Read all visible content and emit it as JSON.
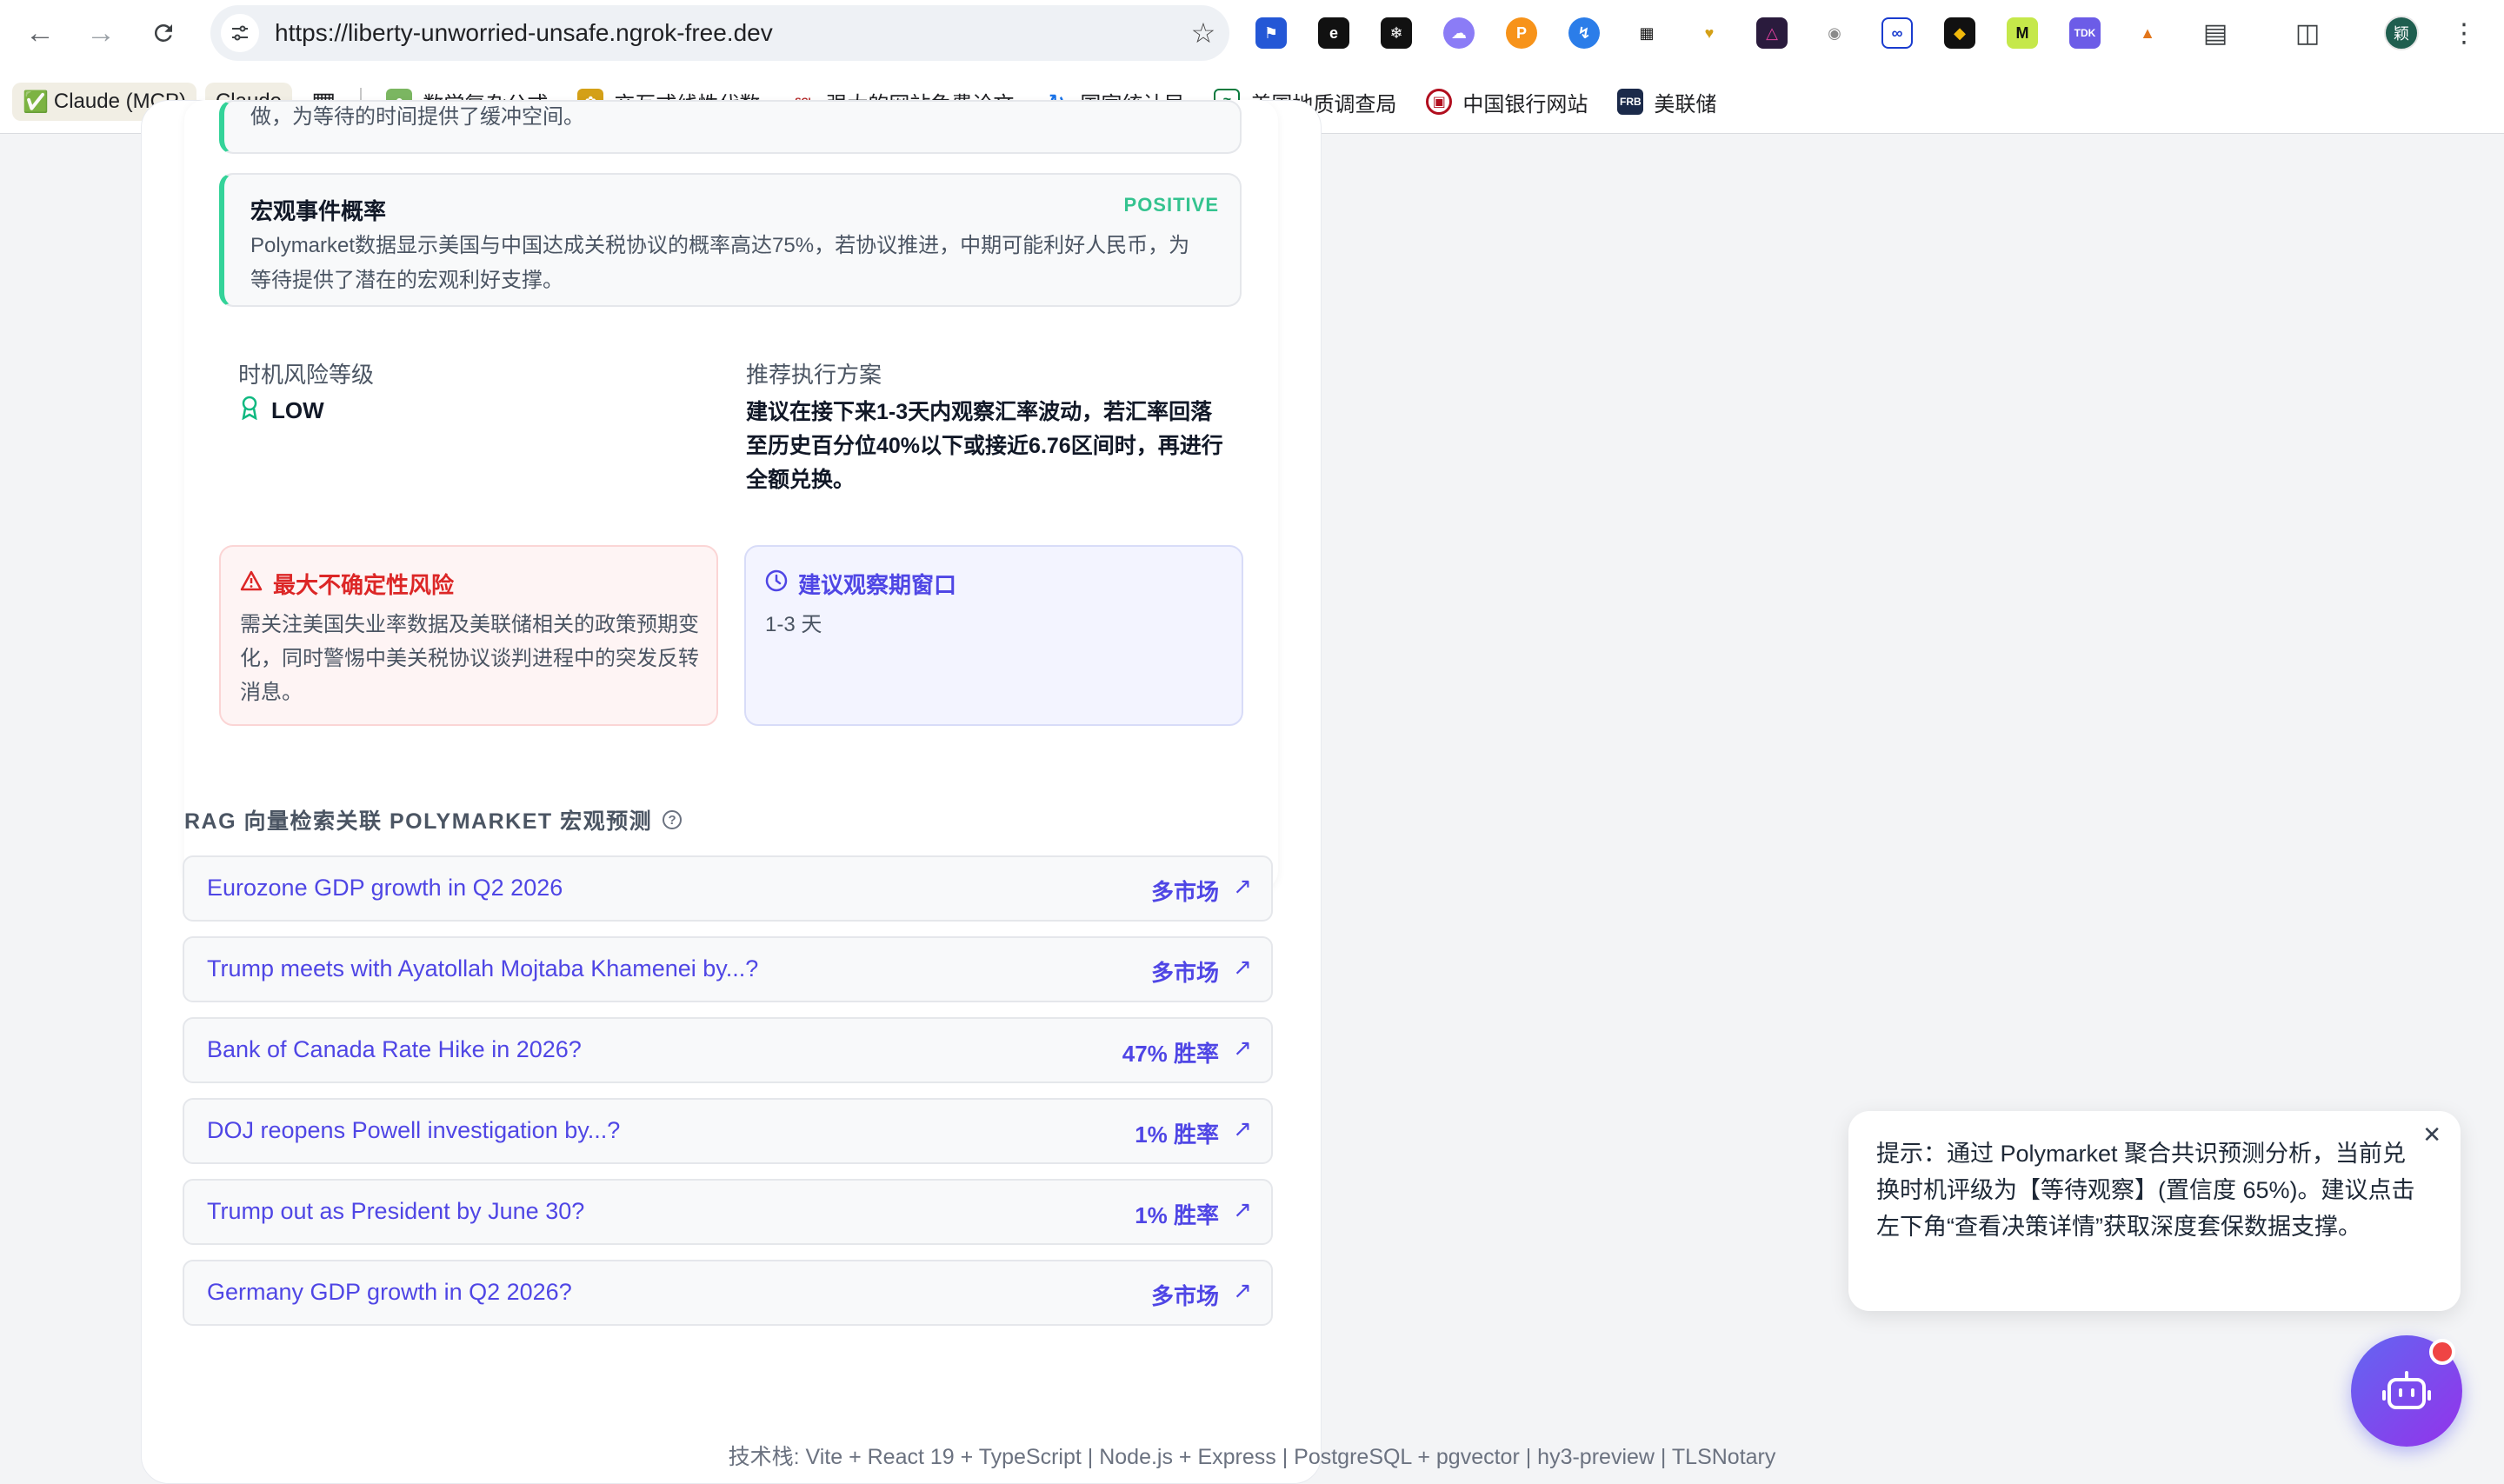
{
  "browser": {
    "url": "https://liberty-unworried-unsafe.ngrok-free.dev",
    "avatar_label": "颖"
  },
  "bookmarks": [
    {
      "label": "Claude (MCP)",
      "icon": "check-icon",
      "prefix": "✅"
    },
    {
      "label": "Claude",
      "icon": "none"
    },
    {
      "label": "数学复杂公式",
      "icon": "frog-icon"
    },
    {
      "label": "交互式线性代数",
      "icon": "bee-icon"
    },
    {
      "label": "强大的网站免费论文",
      "icon": "scihub-icon"
    },
    {
      "label": "国家统计局",
      "icon": "stats-icon"
    },
    {
      "label": "美国地质调查局",
      "icon": "usgs-icon"
    },
    {
      "label": "中国银行网站",
      "icon": "boc-icon"
    },
    {
      "label": "美联储",
      "icon": "frb-icon"
    }
  ],
  "factor_partial": {
    "text": "做，为等待的时间提供了缓冲空间。"
  },
  "factor": {
    "title": "宏观事件概率",
    "tag": "POSITIVE",
    "body": "Polymarket数据显示美国与中国达成关税协议的概率高达75%，若协议推进，中期可能利好人民币，为等待提供了潜在的宏观利好支撑。"
  },
  "timing": {
    "risk_label": "时机风险等级",
    "risk_value": "LOW",
    "plan_label": "推荐执行方案",
    "plan_text": "建议在接下来1-3天内观察汇率波动，若汇率回落至历史百分位40%以下或接近6.76区间时，再进行全额兑换。"
  },
  "uncertainty": {
    "title": "最大不确定性风险",
    "body": "需关注美国失业率数据及美联储相关的政策预期变化，同时警惕中美关税协议谈判进程中的突发反转消息。"
  },
  "window": {
    "title": "建议观察期窗口",
    "value": "1-3 天"
  },
  "rag": {
    "title": "RAG 向量检索关联 POLYMARKET 宏观预测",
    "items": [
      {
        "question": "Eurozone GDP growth in Q2 2026",
        "meta": "多市场"
      },
      {
        "question": "Trump meets with Ayatollah Mojtaba Khamenei by...?",
        "meta": "多市场"
      },
      {
        "question": "Bank of Canada Rate Hike in 2026?",
        "meta": "47% 胜率"
      },
      {
        "question": "DOJ reopens Powell investigation by...?",
        "meta": "1% 胜率"
      },
      {
        "question": "Trump out as President by June 30?",
        "meta": "1% 胜率"
      },
      {
        "question": "Germany GDP growth in Q2 2026?",
        "meta": "多市场"
      }
    ]
  },
  "toast": {
    "text": "提示：通过 Polymarket 聚合共识预测分析，当前兑换时机评级为【等待观察】(置信度 65%)。建议点击左下角“查看决策详情”获取深度套保数据支撑。"
  },
  "footer": {
    "text": "技术栈: Vite + React 19 + TypeScript | Node.js + Express | PostgreSQL + pgvector | hy3-preview | TLSNotary"
  },
  "colors": {
    "accent": "#4f46e5",
    "positive": "#34c38f",
    "danger": "#dc2626"
  }
}
